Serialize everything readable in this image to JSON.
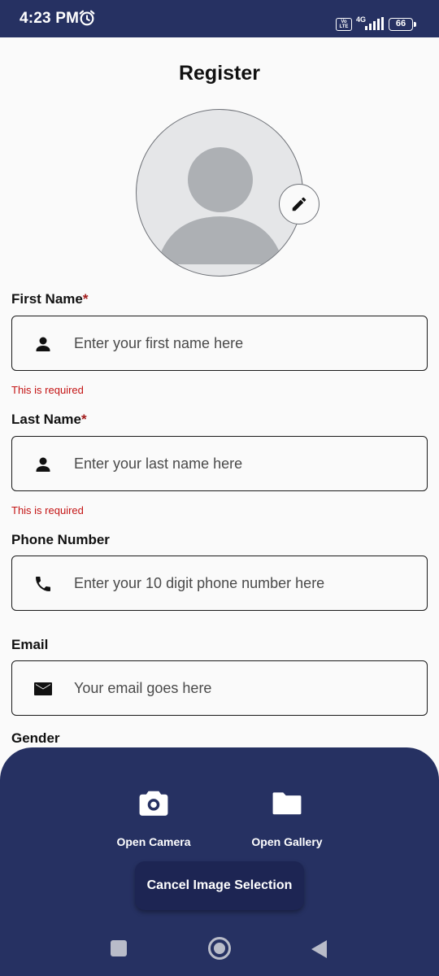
{
  "status_bar": {
    "time": "4:23 PM",
    "volte": "Vo LTE",
    "network": "4G",
    "battery": "66"
  },
  "page": {
    "title": "Register"
  },
  "form": {
    "first_name": {
      "label": "First Name",
      "required_mark": "*",
      "placeholder": "Enter your first name here",
      "error": "This is required",
      "icon": "person-icon"
    },
    "last_name": {
      "label": "Last Name",
      "required_mark": "*",
      "placeholder": "Enter your last name here",
      "error": "This is required",
      "icon": "person-icon"
    },
    "phone": {
      "label": "Phone Number",
      "placeholder": "Enter your 10 digit phone number here",
      "icon": "phone-icon"
    },
    "email": {
      "label": "Email",
      "placeholder": "Your email goes here",
      "icon": "mail-icon"
    },
    "gender": {
      "label": "Gender"
    }
  },
  "bottom_sheet": {
    "camera_label": "Open Camera",
    "gallery_label": "Open Gallery",
    "cancel_label": "Cancel Image Selection"
  },
  "colors": {
    "primary": "#263162",
    "cancel_button": "#1d2553",
    "error": "#c41414",
    "required_star": "#a11a1a"
  }
}
